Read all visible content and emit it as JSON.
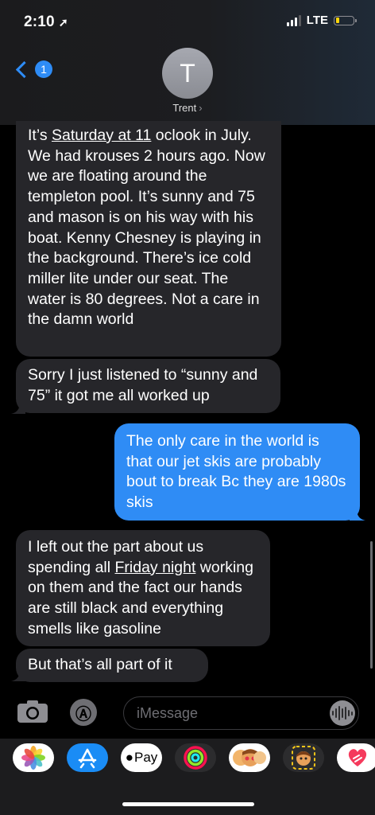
{
  "status_bar": {
    "time": "2:10",
    "network": "LTE"
  },
  "header": {
    "unread_badge": "1",
    "avatar_initial": "T",
    "contact_name": "Trent",
    "contact_chevron": "›"
  },
  "messages": [
    {
      "sender": "received",
      "before": "It’s ",
      "underlined": "Saturday at 11",
      "after": " oclook in July. We had krouses 2 hours ago. Now we are floating around the templeton pool. It’s sunny and 75 and mason is on his way with his boat. Kenny Chesney is playing in the background. There’s ice cold miller lite under our seat. The water is 80 degrees. Not a care in the damn world"
    },
    {
      "sender": "received",
      "text": "Sorry I just listened to “sunny and 75” it got me all worked up"
    },
    {
      "sender": "sent",
      "text": "The only care in the world is that our jet skis are probably bout to break Bc they are 1980s skis"
    },
    {
      "sender": "received",
      "before": "I left out the part about us spending all ",
      "underlined": "Friday night",
      "after": " working on them and the fact our hands are still black and everything smells like gasoline"
    },
    {
      "sender": "received",
      "text": "But that’s all part of it"
    }
  ],
  "compose": {
    "placeholder": "iMessage"
  },
  "app_drawer": {
    "apple_pay_label": "Pay",
    "apps": [
      "photos-icon",
      "app-store-icon",
      "apple-pay-icon",
      "activity-icon",
      "memoji-icon",
      "memoji-stickers-icon",
      "digital-touch-icon"
    ]
  },
  "colors": {
    "sent_bubble": "#2f8cf5",
    "received_bubble": "#26262a",
    "accent": "#2e8cf6"
  }
}
